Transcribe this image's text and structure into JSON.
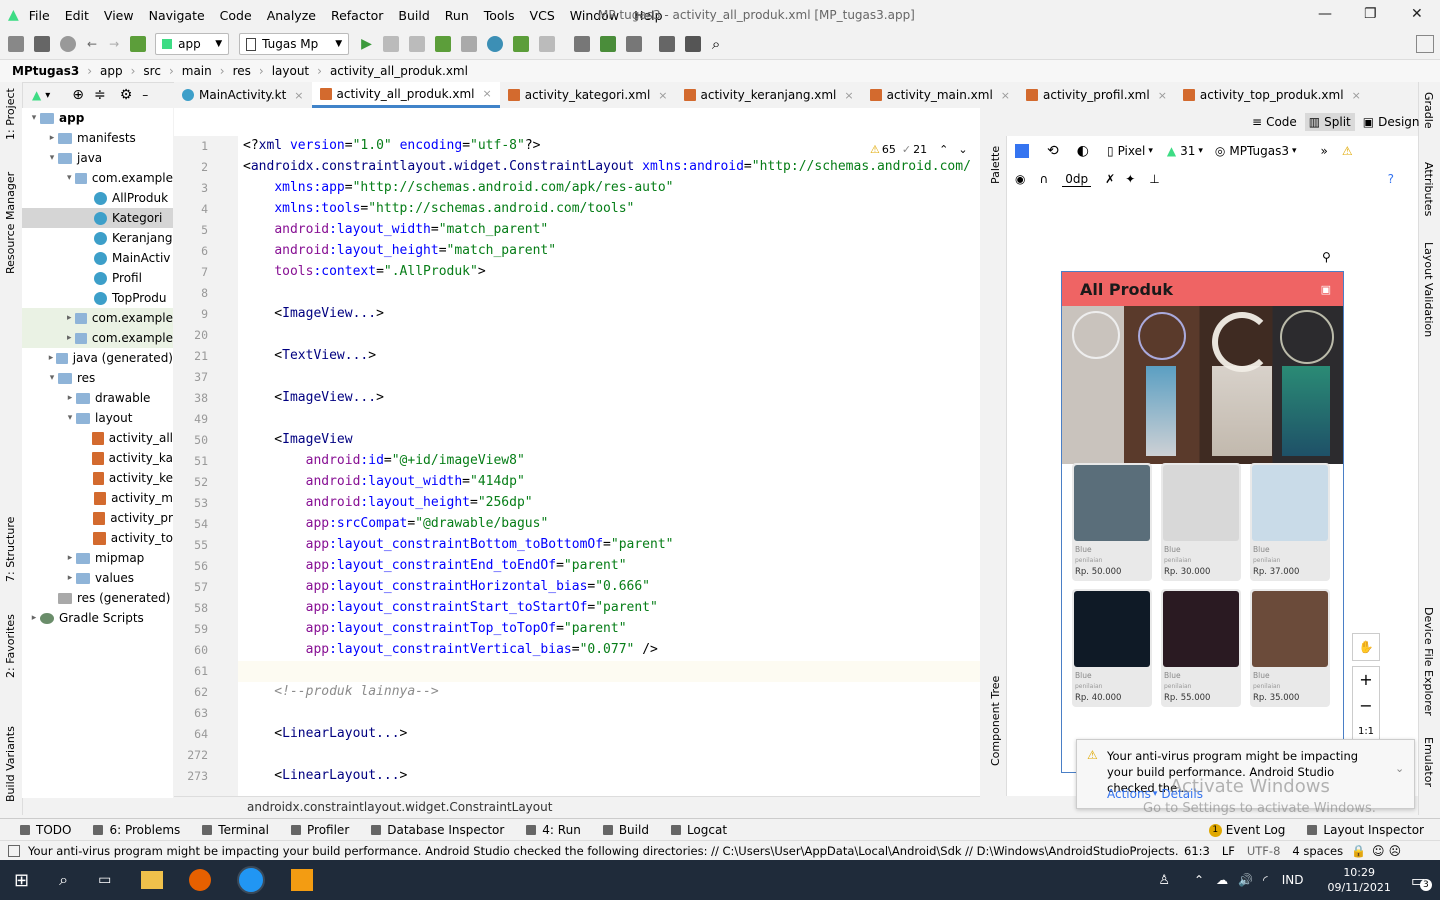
{
  "menu": {
    "items": [
      "File",
      "Edit",
      "View",
      "Navigate",
      "Code",
      "Analyze",
      "Refactor",
      "Build",
      "Run",
      "Tools",
      "VCS",
      "Window",
      "Help"
    ],
    "window_title": "MP tugas3 - activity_all_produk.xml [MP_tugas3.app]"
  },
  "toolbar": {
    "run_config": "app",
    "device": "Tugas Mp"
  },
  "breadcrumb": [
    "MPtugas3",
    "app",
    "src",
    "main",
    "res",
    "layout",
    "activity_all_produk.xml"
  ],
  "left_stripe": {
    "project": "1: Project",
    "resource_manager": "Resource Manager",
    "structure": "7: Structure",
    "favorites": "2: Favorites",
    "build_variants": "Build Variants"
  },
  "right_stripe": {
    "gradle": "Gradle",
    "attributes": "Attributes",
    "layout_validation": "Layout Validation",
    "device_file_explorer": "Device File Explorer",
    "emulator": "Emulator"
  },
  "project_tree": [
    {
      "label": "app",
      "level": 0,
      "arrow": "▾",
      "icon": "folder",
      "bold": true
    },
    {
      "label": "manifests",
      "level": 1,
      "arrow": "▸",
      "icon": "folder"
    },
    {
      "label": "java",
      "level": 1,
      "arrow": "▾",
      "icon": "folder"
    },
    {
      "label": "com.example",
      "level": 2,
      "arrow": "▾",
      "icon": "folder"
    },
    {
      "label": "AllProduk",
      "level": 3,
      "arrow": "",
      "icon": "class"
    },
    {
      "label": "Kategori",
      "level": 3,
      "arrow": "",
      "icon": "class",
      "selected": true
    },
    {
      "label": "Keranjang",
      "level": 3,
      "arrow": "",
      "icon": "class"
    },
    {
      "label": "MainActiv",
      "level": 3,
      "arrow": "",
      "icon": "class"
    },
    {
      "label": "Profil",
      "level": 3,
      "arrow": "",
      "icon": "class"
    },
    {
      "label": "TopProdu",
      "level": 3,
      "arrow": "",
      "icon": "class"
    },
    {
      "label": "com.example",
      "level": 2,
      "arrow": "▸",
      "icon": "folder",
      "green": true
    },
    {
      "label": "com.example",
      "level": 2,
      "arrow": "▸",
      "icon": "folder",
      "green": true
    },
    {
      "label": "java (generated)",
      "level": 1,
      "arrow": "▸",
      "icon": "folder"
    },
    {
      "label": "res",
      "level": 1,
      "arrow": "▾",
      "icon": "folder"
    },
    {
      "label": "drawable",
      "level": 2,
      "arrow": "▸",
      "icon": "folder"
    },
    {
      "label": "layout",
      "level": 2,
      "arrow": "▾",
      "icon": "folder"
    },
    {
      "label": "activity_all",
      "level": 3,
      "arrow": "",
      "icon": "xml"
    },
    {
      "label": "activity_ka",
      "level": 3,
      "arrow": "",
      "icon": "xml"
    },
    {
      "label": "activity_ke",
      "level": 3,
      "arrow": "",
      "icon": "xml"
    },
    {
      "label": "activity_m",
      "level": 3,
      "arrow": "",
      "icon": "xml"
    },
    {
      "label": "activity_pr",
      "level": 3,
      "arrow": "",
      "icon": "xml"
    },
    {
      "label": "activity_to",
      "level": 3,
      "arrow": "",
      "icon": "xml"
    },
    {
      "label": "mipmap",
      "level": 2,
      "arrow": "▸",
      "icon": "folder"
    },
    {
      "label": "values",
      "level": 2,
      "arrow": "▸",
      "icon": "folder"
    },
    {
      "label": "res (generated)",
      "level": 1,
      "arrow": "",
      "icon": "folder-gray"
    },
    {
      "label": "Gradle Scripts",
      "level": 0,
      "arrow": "▸",
      "icon": "gradle"
    }
  ],
  "tabs": [
    {
      "label": "MainActivity.kt",
      "active": false,
      "icon": "kt"
    },
    {
      "label": "activity_all_produk.xml",
      "active": true,
      "icon": "xml"
    },
    {
      "label": "activity_kategori.xml",
      "active": false,
      "icon": "xml"
    },
    {
      "label": "activity_keranjang.xml",
      "active": false,
      "icon": "xml"
    },
    {
      "label": "activity_main.xml",
      "active": false,
      "icon": "xml"
    },
    {
      "label": "activity_profil.xml",
      "active": false,
      "icon": "xml"
    },
    {
      "label": "activity_top_produk.xml",
      "active": false,
      "icon": "xml"
    }
  ],
  "editor": {
    "warnings": "65",
    "weak_warnings": "21",
    "lines": [
      {
        "n": "1",
        "parts": [
          [
            "t",
            "<?"
          ],
          [
            "tg",
            "xml "
          ],
          [
            "an",
            "version"
          ],
          [
            "t",
            "="
          ],
          [
            "av",
            "\"1.0\" "
          ],
          [
            "an",
            "encoding"
          ],
          [
            "t",
            "="
          ],
          [
            "av",
            "\"utf-8\""
          ],
          [
            "t",
            "?>"
          ]
        ]
      },
      {
        "n": "2",
        "parts": [
          [
            "t",
            "<"
          ],
          [
            "tg",
            "androidx.constraintlayout.widget.ConstraintLayout "
          ],
          [
            "an",
            "xmlns:android"
          ],
          [
            "t",
            "="
          ],
          [
            "av",
            "\"http://schemas.android.com/"
          ]
        ]
      },
      {
        "n": "3",
        "parts": [
          [
            "t",
            "    "
          ],
          [
            "an",
            "xmlns:app"
          ],
          [
            "t",
            "="
          ],
          [
            "av",
            "\"http://schemas.android.com/apk/res-auto\""
          ]
        ]
      },
      {
        "n": "4",
        "parts": [
          [
            "t",
            "    "
          ],
          [
            "an",
            "xmlns:tools"
          ],
          [
            "t",
            "="
          ],
          [
            "av",
            "\"http://schemas.android.com/tools\""
          ]
        ]
      },
      {
        "n": "5",
        "parts": [
          [
            "t",
            "    "
          ],
          [
            "pr",
            "android"
          ],
          [
            "an",
            ":layout_width"
          ],
          [
            "t",
            "="
          ],
          [
            "av",
            "\"match_parent\""
          ]
        ]
      },
      {
        "n": "6",
        "parts": [
          [
            "t",
            "    "
          ],
          [
            "pr",
            "android"
          ],
          [
            "an",
            ":layout_height"
          ],
          [
            "t",
            "="
          ],
          [
            "av",
            "\"match_parent\""
          ]
        ]
      },
      {
        "n": "7",
        "parts": [
          [
            "t",
            "    "
          ],
          [
            "pr",
            "tools"
          ],
          [
            "an",
            ":context"
          ],
          [
            "t",
            "="
          ],
          [
            "av",
            "\".AllProduk\""
          ],
          [
            "t",
            ">"
          ]
        ]
      },
      {
        "n": "8",
        "parts": []
      },
      {
        "n": "9",
        "parts": [
          [
            "t",
            "    <"
          ],
          [
            "tg",
            "ImageView..."
          ],
          [
            "t",
            ">"
          ]
        ]
      },
      {
        "n": "20",
        "parts": []
      },
      {
        "n": "21",
        "parts": [
          [
            "t",
            "    <"
          ],
          [
            "tg",
            "TextView..."
          ],
          [
            "t",
            ">"
          ]
        ]
      },
      {
        "n": "37",
        "parts": []
      },
      {
        "n": "38",
        "parts": [
          [
            "t",
            "    <"
          ],
          [
            "tg",
            "ImageView..."
          ],
          [
            "t",
            ">"
          ]
        ]
      },
      {
        "n": "49",
        "parts": []
      },
      {
        "n": "50",
        "parts": [
          [
            "t",
            "    <"
          ],
          [
            "tg",
            "ImageView"
          ]
        ]
      },
      {
        "n": "51",
        "parts": [
          [
            "t",
            "        "
          ],
          [
            "pr",
            "android"
          ],
          [
            "an",
            ":id"
          ],
          [
            "t",
            "="
          ],
          [
            "av",
            "\"@+id/imageView8\""
          ]
        ]
      },
      {
        "n": "52",
        "parts": [
          [
            "t",
            "        "
          ],
          [
            "pr",
            "android"
          ],
          [
            "an",
            ":layout_width"
          ],
          [
            "t",
            "="
          ],
          [
            "av",
            "\"414dp\""
          ]
        ]
      },
      {
        "n": "53",
        "parts": [
          [
            "t",
            "        "
          ],
          [
            "pr",
            "android"
          ],
          [
            "an",
            ":layout_height"
          ],
          [
            "t",
            "="
          ],
          [
            "av",
            "\"256dp\""
          ]
        ]
      },
      {
        "n": "54",
        "parts": [
          [
            "t",
            "        "
          ],
          [
            "pr",
            "app"
          ],
          [
            "an",
            ":srcCompat"
          ],
          [
            "t",
            "="
          ],
          [
            "av",
            "\"@drawable/bagus\""
          ]
        ]
      },
      {
        "n": "55",
        "parts": [
          [
            "t",
            "        "
          ],
          [
            "pr",
            "app"
          ],
          [
            "an",
            ":layout_constraintBottom_toBottomOf"
          ],
          [
            "t",
            "="
          ],
          [
            "av",
            "\"parent\""
          ]
        ]
      },
      {
        "n": "56",
        "parts": [
          [
            "t",
            "        "
          ],
          [
            "pr",
            "app"
          ],
          [
            "an",
            ":layout_constraintEnd_toEndOf"
          ],
          [
            "t",
            "="
          ],
          [
            "av",
            "\"parent\""
          ]
        ]
      },
      {
        "n": "57",
        "parts": [
          [
            "t",
            "        "
          ],
          [
            "pr",
            "app"
          ],
          [
            "an",
            ":layout_constraintHorizontal_bias"
          ],
          [
            "t",
            "="
          ],
          [
            "av",
            "\"0.666\""
          ]
        ]
      },
      {
        "n": "58",
        "parts": [
          [
            "t",
            "        "
          ],
          [
            "pr",
            "app"
          ],
          [
            "an",
            ":layout_constraintStart_toStartOf"
          ],
          [
            "t",
            "="
          ],
          [
            "av",
            "\"parent\""
          ]
        ]
      },
      {
        "n": "59",
        "parts": [
          [
            "t",
            "        "
          ],
          [
            "pr",
            "app"
          ],
          [
            "an",
            ":layout_constraintTop_toTopOf"
          ],
          [
            "t",
            "="
          ],
          [
            "av",
            "\"parent\""
          ]
        ]
      },
      {
        "n": "60",
        "parts": [
          [
            "t",
            "        "
          ],
          [
            "pr",
            "app"
          ],
          [
            "an",
            ":layout_constraintVertical_bias"
          ],
          [
            "t",
            "="
          ],
          [
            "av",
            "\"0.077\""
          ],
          [
            "t",
            " />"
          ]
        ]
      },
      {
        "n": "61",
        "parts": []
      },
      {
        "n": "62",
        "parts": [
          [
            "cm",
            "    <!--produk lainnya-->"
          ]
        ]
      },
      {
        "n": "63",
        "parts": []
      },
      {
        "n": "64",
        "parts": [
          [
            "t",
            "    <"
          ],
          [
            "tg",
            "LinearLayout..."
          ],
          [
            "t",
            ">"
          ]
        ]
      },
      {
        "n": "272",
        "parts": []
      },
      {
        "n": "273",
        "parts": [
          [
            "t",
            "    <"
          ],
          [
            "tg",
            "LinearLayout..."
          ],
          [
            "t",
            ">"
          ]
        ]
      }
    ],
    "status_crumb": "androidx.constraintlayout.widget.ConstraintLayout"
  },
  "view_modes": {
    "code": "Code",
    "split": "Split",
    "design": "Design"
  },
  "design_toolbar": {
    "device": "Pixel",
    "api": "31",
    "theme": "MPTugas3",
    "margin": "0dp"
  },
  "palette_labels": {
    "palette": "Palette",
    "component_tree": "Component Tree"
  },
  "preview": {
    "app_title": "All Produk",
    "products": [
      {
        "name": "Blue",
        "rating": "penilaian",
        "price": "Rp. 50.000",
        "color": "#5a6e7a"
      },
      {
        "name": "Blue",
        "rating": "penilaian",
        "price": "Rp. 30.000",
        "color": "#d8d8d8"
      },
      {
        "name": "Blue",
        "rating": "penilaian",
        "price": "Rp. 37.000",
        "color": "#c9dbe8"
      },
      {
        "name": "Blue",
        "rating": "penilaian",
        "price": "Rp. 40.000",
        "color": "#0f1a26"
      },
      {
        "name": "Blue",
        "rating": "penilaian",
        "price": "Rp. 55.000",
        "color": "#2a1a22"
      },
      {
        "name": "Blue",
        "rating": "penilaian",
        "price": "Rp. 35.000",
        "color": "#6b4b3a"
      }
    ]
  },
  "zoom": {
    "ratio": "1:1"
  },
  "notification": {
    "text": "Your anti-virus program might be impacting your build performance. Android Studio checked the...",
    "actions": "Actions",
    "details": "Details"
  },
  "watermark": {
    "line1": "Activate Windows",
    "line2": "Go to Settings to activate Windows."
  },
  "tool_windows": [
    {
      "label": "TODO"
    },
    {
      "label": "6: Problems"
    },
    {
      "label": "Terminal"
    },
    {
      "label": "Profiler"
    },
    {
      "label": "Database Inspector"
    },
    {
      "label": "4: Run"
    },
    {
      "label": "Build"
    },
    {
      "label": "Logcat"
    }
  ],
  "tool_windows_right": {
    "event_log_count": "1",
    "event_log": "Event Log",
    "layout_inspector": "Layout Inspector"
  },
  "status_bar": {
    "message": "Your anti-virus program might be impacting your build performance. Android Studio checked the following directories: // C:\\Users\\User\\AppData\\Local\\Android\\Sdk // D:\\Windows\\AndroidStudioProjects... (today 9:03)",
    "position": "61:3",
    "line_sep": "LF",
    "encoding": "UTF-8",
    "indent": "4 spaces"
  },
  "taskbar": {
    "lang": "IND",
    "time": "10:29",
    "date": "09/11/2021",
    "notif_count": "3"
  }
}
